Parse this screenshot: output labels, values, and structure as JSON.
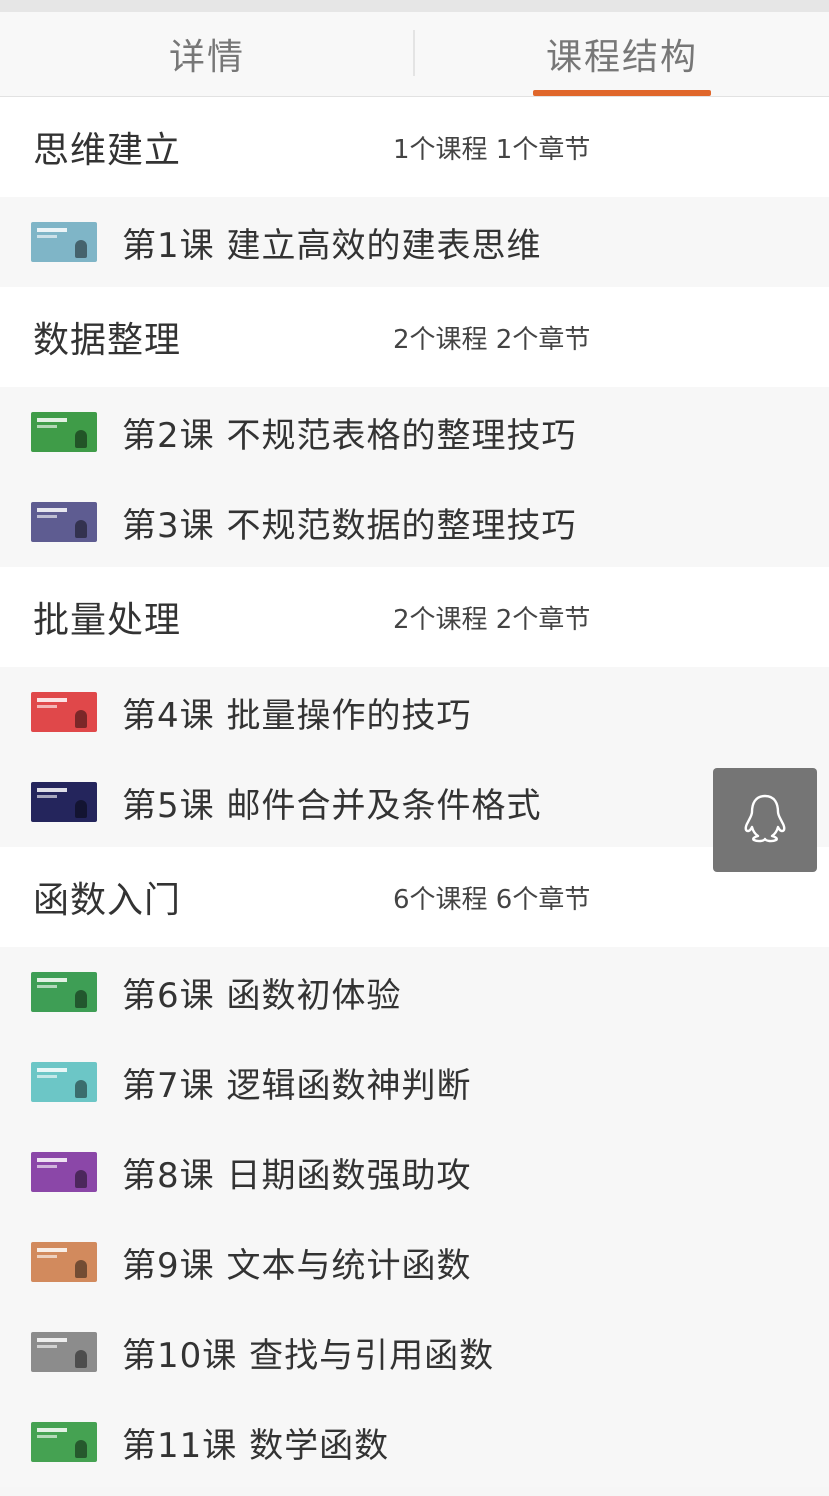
{
  "tabs": [
    {
      "label": "详情"
    },
    {
      "label": "课程结构"
    }
  ],
  "colors": {
    "accent": "#e0672b"
  },
  "sections": [
    {
      "title": "思维建立",
      "meta": "1个课程 1个章节",
      "lessons": [
        {
          "title": "第1课  建立高效的建表思维",
          "thumb_color": "#7fb5c7"
        }
      ]
    },
    {
      "title": "数据整理",
      "meta": "2个课程 2个章节",
      "lessons": [
        {
          "title": "第2课  不规范表格的整理技巧",
          "thumb_color": "#3f9c48"
        },
        {
          "title": "第3课  不规范数据的整理技巧",
          "thumb_color": "#5e5c91"
        }
      ]
    },
    {
      "title": "批量处理",
      "meta": "2个课程 2个章节",
      "lessons": [
        {
          "title": "第4课  批量操作的技巧",
          "thumb_color": "#e0484a"
        },
        {
          "title": "第5课  邮件合并及条件格式",
          "thumb_color": "#24255c"
        }
      ]
    },
    {
      "title": "函数入门",
      "meta": "6个课程 6个章节",
      "lessons": [
        {
          "title": "第6课  函数初体验",
          "thumb_color": "#3e9e55"
        },
        {
          "title": "第7课  逻辑函数神判断",
          "thumb_color": "#6cc6c6"
        },
        {
          "title": "第8课  日期函数强助攻",
          "thumb_color": "#8b47a8"
        },
        {
          "title": "第9课  文本与统计函数",
          "thumb_color": "#d28a5d"
        },
        {
          "title": "第10课  查找与引用函数",
          "thumb_color": "#8c8c8c"
        },
        {
          "title": "第11课  数学函数",
          "thumb_color": "#45a252"
        }
      ]
    }
  ],
  "floating": {
    "icon": "qq-penguin-icon"
  }
}
